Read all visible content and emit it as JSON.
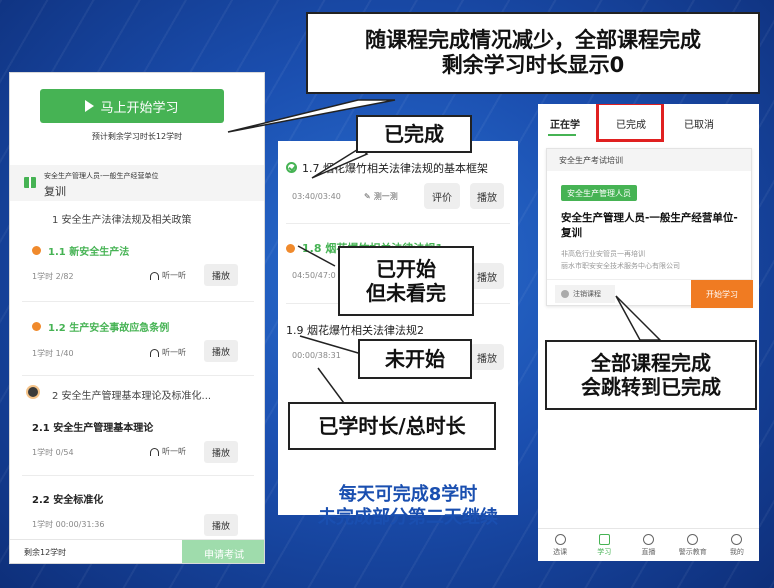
{
  "top_callout": {
    "line1": "随课程完成情况减少，全部课程完成",
    "line2": "剩余学习时长显示0"
  },
  "left_panel": {
    "start_button": "马上开始学习",
    "remaining_hint": "预计剩余学习时长12学时",
    "section": {
      "title": "安全生产管理人员-一般生产经营单位",
      "subtitle": "复训"
    },
    "chapter1": "1  安全生产法律法规及相关政策",
    "items": [
      {
        "title": "1.1  新安全生产法",
        "meta": "1学时  2/82",
        "listen": "听一听",
        "play": "播放"
      },
      {
        "title": "1.2  生产安全事故应急条例",
        "meta": "1学时  1/40",
        "listen": "听一听",
        "play": "播放"
      }
    ],
    "chapter2": "2  安全生产管理基本理论及标准化...",
    "items2": [
      {
        "title": "2.1  安全生产管理基本理论",
        "meta": "1学时  0/54",
        "listen": "听一听",
        "play": "播放"
      },
      {
        "title": "2.2  安全标准化",
        "meta": "1学时  00:00/31:36",
        "play": "播放"
      }
    ],
    "footer": {
      "remaining": "剩余12学时",
      "apply": "申请考试"
    }
  },
  "middle_panel": {
    "item1": {
      "title": "1.7  烟花爆竹相关法律法规的基本框架",
      "time": "03:40/03:40",
      "test": "测一测",
      "rate": "评价",
      "play": "播放"
    },
    "item2": {
      "title": "1.8  烟花爆竹相关法律法规1",
      "time": "04:50/47:0",
      "play": "播放"
    },
    "item3": {
      "title": "1.9  烟花爆竹相关法律法规2",
      "time": "00:00/38:31",
      "play": "播放"
    }
  },
  "callouts": {
    "completed": "已完成",
    "started_line1": "已开始",
    "started_line2": "但未看完",
    "not_started": "未开始",
    "time_label": "已学时长/总时长",
    "jump_line1": "全部课程完成",
    "jump_line2": "会跳转到已完成"
  },
  "caption": {
    "line1": "每天可完成8学时",
    "line2": "未完成部分第二天继续"
  },
  "right_panel": {
    "tabs": [
      "正在学",
      "已完成",
      "已取消"
    ],
    "card": {
      "header": "安全生产考试培训",
      "tag": "安全生产管理人员",
      "title": "安全生产管理人员-一般生产经营单位-复训",
      "line1": "非高危行业安管员一再培训",
      "line2": "丽水市职安安全技术服务中心有限公司",
      "cancel": "注销课程",
      "start": "开始学习"
    },
    "nav": [
      "选课",
      "学习",
      "直播",
      "警示教育",
      "我的"
    ]
  },
  "colors": {
    "accent_green": "#46b354",
    "orange": "#f07b22",
    "highlight_red": "#e02020",
    "caption_blue": "#1a4fb0"
  }
}
